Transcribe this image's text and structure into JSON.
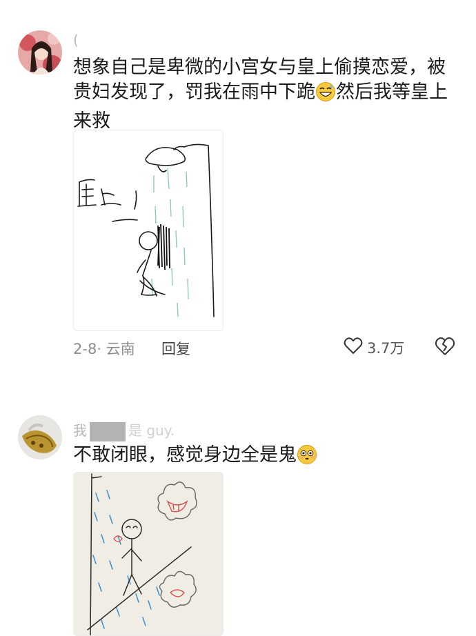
{
  "comments": [
    {
      "username": "(",
      "text": "想象自己是卑微的小宫女与皇上偷摸恋爱，被贵妇发现了，罚我在雨中下跪😅然后我等皇上来救",
      "text_parts": [
        "想象自己是卑微的小宫女与皇上偷摸恋爱，被",
        "贵妇发现了，罚我在雨中下跪",
        "然后我等皇上",
        "来救"
      ],
      "drawing_text": "皇上",
      "date_location": "2-8· 云南",
      "reply_label": "回复",
      "likes": "3.7万",
      "icons": [
        "avatar",
        "grinning-sweat-emoji",
        "heart-outline-icon",
        "broken-heart-icon"
      ]
    },
    {
      "username_prefix": "我",
      "username_suffix": "是 guy.",
      "text": "不敢闭眼，感觉身边全是鬼",
      "icons": [
        "avatar",
        "flushed-emoji"
      ]
    }
  ]
}
